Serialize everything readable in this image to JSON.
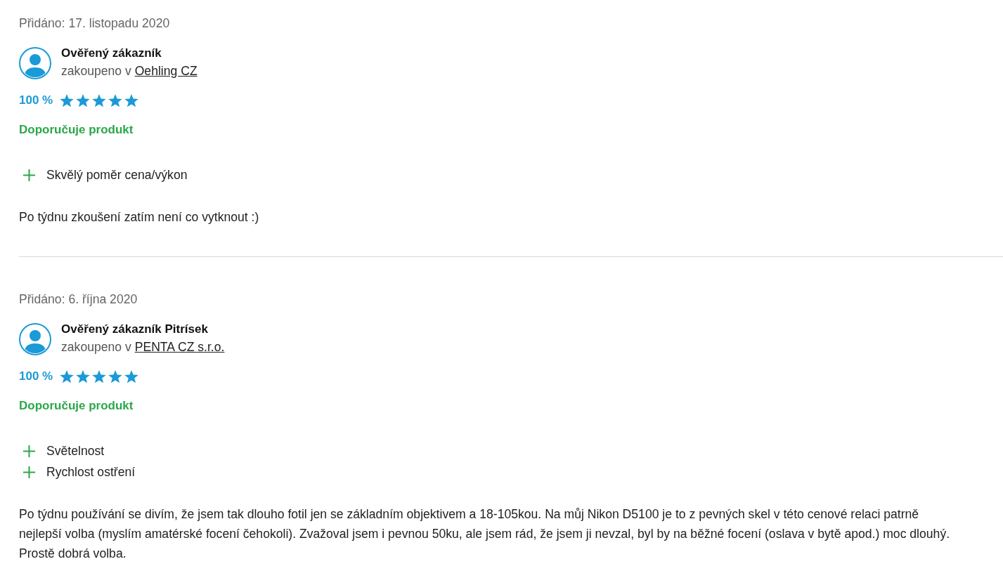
{
  "reviews": [
    {
      "added": "Přidáno: 17. listopadu 2020",
      "author": "Ověřený zákazník",
      "purchase_prefix": "zakoupeno v",
      "shop": "Oehling CZ",
      "rating": "100 %",
      "stars": 5,
      "recommendation": "Doporučuje produkt",
      "pros": [
        "Skvělý poměr cena/výkon"
      ],
      "text": "Po týdnu zkoušení zatím není co vytknout :)"
    },
    {
      "added": "Přidáno: 6. října 2020",
      "author": "Ověřený zákazník Pitrísek",
      "purchase_prefix": "zakoupeno v",
      "shop": "PENTA CZ s.r.o.",
      "rating": "100 %",
      "stars": 5,
      "recommendation": "Doporučuje produkt",
      "pros": [
        "Světelnost",
        "Rychlost ostření"
      ],
      "text": "Po týdnu používání se divím, že jsem tak dlouho fotil jen se základním objektivem a 18-105kou. Na můj Nikon D5100 je to z pevných skel v této cenové relaci patrně nejlepší volba (myslím amatérské focení čehokoli). Zvažoval jsem i pevnou 50ku, ale jsem rád, že jsem ji nevzal, byl by na běžné focení (oslava v bytě apod.) moc dlouhý. Prostě dobrá volba."
    }
  ]
}
